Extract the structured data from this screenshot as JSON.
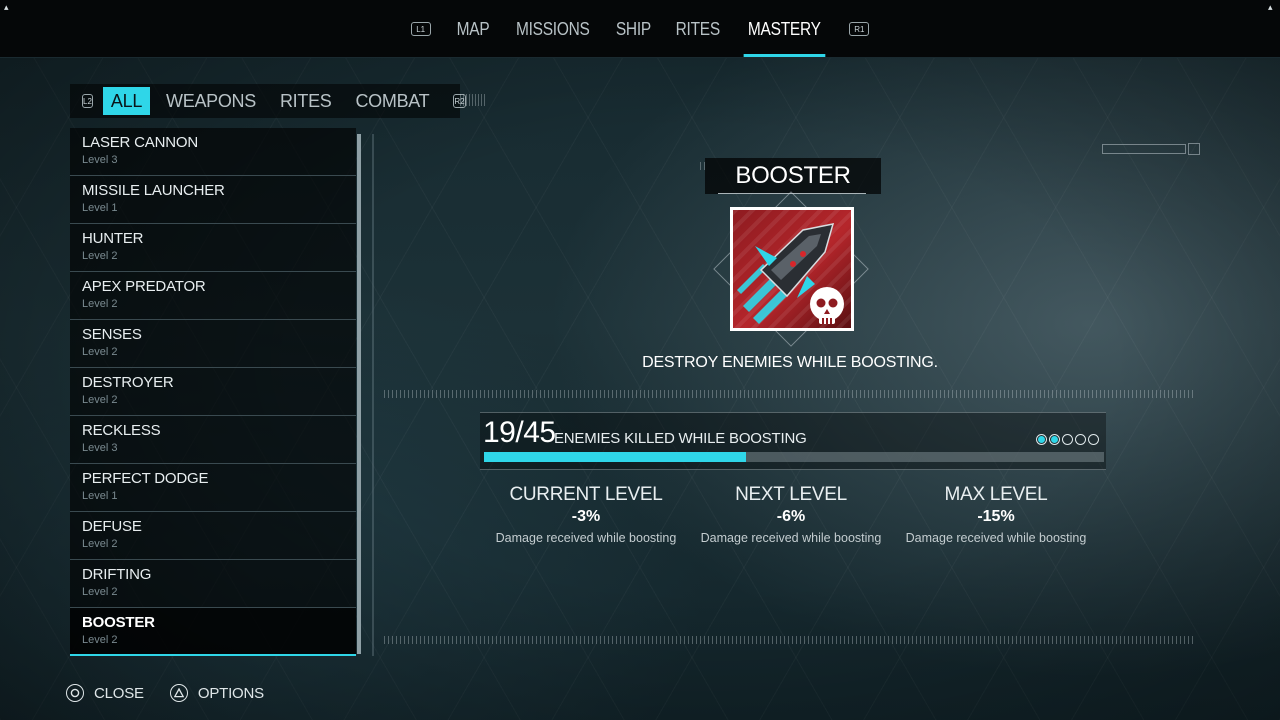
{
  "top_nav": {
    "left_hint": "L1",
    "right_hint": "R1",
    "tabs": [
      {
        "label": "MAP",
        "active": false
      },
      {
        "label": "MISSIONS",
        "active": false
      },
      {
        "label": "SHIP",
        "active": false
      },
      {
        "label": "RITES",
        "active": false
      },
      {
        "label": "MASTERY",
        "active": true
      }
    ]
  },
  "categories": {
    "left_hint": "L2",
    "right_hint": "R2",
    "tabs": [
      {
        "label": "ALL",
        "active": true
      },
      {
        "label": "WEAPONS",
        "active": false
      },
      {
        "label": "RITES",
        "active": false
      },
      {
        "label": "COMBAT",
        "active": false
      }
    ]
  },
  "mastery_list": [
    {
      "name": "LASER CANNON",
      "level": "Level 3"
    },
    {
      "name": "MISSILE LAUNCHER",
      "level": "Level 1"
    },
    {
      "name": "HUNTER",
      "level": "Level 2"
    },
    {
      "name": "APEX PREDATOR",
      "level": "Level 2"
    },
    {
      "name": "SENSES",
      "level": "Level 2"
    },
    {
      "name": "DESTROYER",
      "level": "Level 2"
    },
    {
      "name": "RECKLESS",
      "level": "Level 3"
    },
    {
      "name": "PERFECT DODGE",
      "level": "Level 1"
    },
    {
      "name": "DEFUSE",
      "level": "Level 2"
    },
    {
      "name": "DRIFTING",
      "level": "Level 2"
    },
    {
      "name": "BOOSTER",
      "level": "Level 2",
      "selected": true
    }
  ],
  "detail": {
    "title": "BOOSTER",
    "description": "DESTROY ENEMIES WHILE BOOSTING.",
    "progress": {
      "count": "19/45",
      "label": "ENEMIES KILLED WHILE BOOSTING",
      "current": 19,
      "target": 45,
      "pips_filled": 2,
      "pips_total": 5
    },
    "levels": [
      {
        "heading": "CURRENT LEVEL",
        "value": "-3%",
        "desc": "Damage received while boosting"
      },
      {
        "heading": "NEXT LEVEL",
        "value": "-6%",
        "desc": "Damage received while boosting"
      },
      {
        "heading": "MAX LEVEL",
        "value": "-15%",
        "desc": "Damage received while boosting"
      }
    ]
  },
  "bottom_actions": [
    {
      "icon": "circle-button-icon",
      "label": "CLOSE"
    },
    {
      "icon": "triangle-button-icon",
      "label": "OPTIONS"
    }
  ],
  "colors": {
    "accent": "#2fd6e8",
    "badge_red": "#b5262b"
  }
}
